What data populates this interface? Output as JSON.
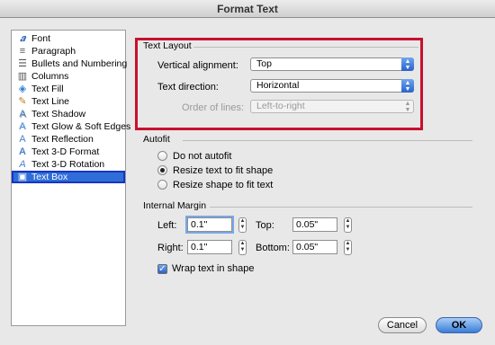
{
  "window": {
    "title": "Format Text"
  },
  "sidebar": {
    "items": [
      {
        "label": "Font",
        "icon": "font-icon",
        "glyph": "𝒂"
      },
      {
        "label": "Paragraph",
        "icon": "paragraph-icon",
        "glyph": "≡"
      },
      {
        "label": "Bullets and Numbering",
        "icon": "bullets-icon",
        "glyph": "☰"
      },
      {
        "label": "Columns",
        "icon": "columns-icon",
        "glyph": "▥"
      },
      {
        "label": "Text Fill",
        "icon": "paint-bucket-icon",
        "glyph": "◈"
      },
      {
        "label": "Text Line",
        "icon": "pencil-icon",
        "glyph": "✎"
      },
      {
        "label": "Text Shadow",
        "icon": "text-shadow-icon",
        "glyph": "A"
      },
      {
        "label": "Text Glow & Soft Edges",
        "icon": "text-glow-icon",
        "glyph": "A"
      },
      {
        "label": "Text Reflection",
        "icon": "text-reflection-icon",
        "glyph": "A"
      },
      {
        "label": "Text 3-D Format",
        "icon": "text-3d-format-icon",
        "glyph": "A"
      },
      {
        "label": "Text 3-D Rotation",
        "icon": "text-3d-rotation-icon",
        "glyph": "A"
      },
      {
        "label": "Text Box",
        "icon": "text-box-icon",
        "glyph": "▣",
        "selected": true
      }
    ]
  },
  "text_layout": {
    "heading": "Text Layout",
    "vertical_alignment": {
      "label": "Vertical alignment:",
      "value": "Top"
    },
    "text_direction": {
      "label": "Text direction:",
      "value": "Horizontal"
    },
    "order_of_lines": {
      "label": "Order of lines:",
      "value": "Left-to-right"
    }
  },
  "autofit": {
    "heading": "Autofit",
    "options": [
      {
        "label": "Do not autofit",
        "selected": false
      },
      {
        "label": "Resize text to fit shape",
        "selected": true
      },
      {
        "label": "Resize shape to fit text",
        "selected": false
      }
    ]
  },
  "internal_margin": {
    "heading": "Internal Margin",
    "left": {
      "label": "Left:",
      "value": "0.1\""
    },
    "top": {
      "label": "Top:",
      "value": "0.05\""
    },
    "right": {
      "label": "Right:",
      "value": "0.1\""
    },
    "bottom": {
      "label": "Bottom:",
      "value": "0.05\""
    },
    "wrap": {
      "label": "Wrap text in shape",
      "checked": true
    }
  },
  "buttons": {
    "cancel": "Cancel",
    "ok": "OK"
  },
  "colors": {
    "highlight": "#c8102e",
    "selection": "#2f6ed6",
    "accent": "#3a7ed8"
  }
}
